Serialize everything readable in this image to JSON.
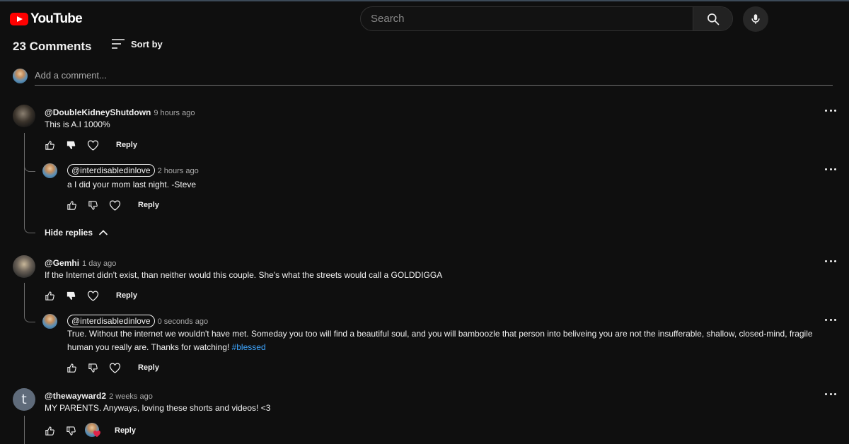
{
  "app": {
    "logo_text": "YouTube"
  },
  "search": {
    "placeholder": "Search"
  },
  "comments_header": {
    "count_text": "23 Comments",
    "sort_label": "Sort by"
  },
  "add_comment": {
    "placeholder": "Add a comment..."
  },
  "threads": [
    {
      "author": "@DoubleKidneyShutdown",
      "time": "9 hours ago",
      "text": "This is A.I 1000%",
      "reply_label": "Reply",
      "replies": [
        {
          "author": "@interdisabledinlove",
          "time": "2 hours ago",
          "text": "a I did your mom last night. -Steve",
          "reply_label": "Reply"
        }
      ],
      "hide_replies_label": "Hide replies"
    },
    {
      "author": "@Gemhi",
      "time": "1 day ago",
      "text": "If the Internet didn't exist, than neither would this couple. She's what the streets would call a GOLDDIGGA",
      "reply_label": "Reply",
      "replies": [
        {
          "author": "@interdisabledinlove",
          "time": "0 seconds ago",
          "text": "True. Without the internet we wouldn't have met. Someday you too will find a beautiful soul, and you will bamboozle that person into beliveing you are not the insufferable, shallow, closed-mind, fragile human you really are. Thanks for watching!",
          "hashtag": "#blessed",
          "reply_label": "Reply"
        }
      ]
    },
    {
      "author": "@thewayward2",
      "time": "2 weeks ago",
      "avatar_letter": "t",
      "text": "MY PARENTS. Anyways, loving these shorts and videos! <3",
      "reply_label": "Reply"
    }
  ],
  "icons": {
    "like": "thumbs-up-icon",
    "dislike": "thumbs-down-icon",
    "heart": "heart-icon",
    "more": "more-vert-icon",
    "sort": "sort-icon",
    "search": "search-icon",
    "mic": "mic-icon",
    "chevron": "chevron-up-icon"
  },
  "colors": {
    "background": "#0f0f0f",
    "brand_red": "#ff0000",
    "hashtag": "#3ea6ff",
    "heart_badge": "#e0244a"
  }
}
